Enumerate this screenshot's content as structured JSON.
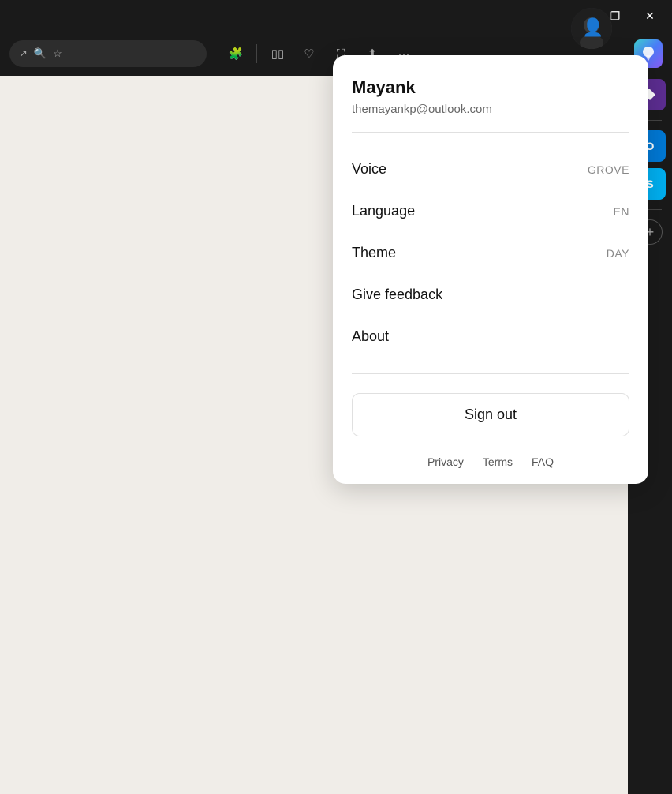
{
  "titleBar": {
    "minimizeLabel": "—",
    "restoreLabel": "❐",
    "closeLabel": "✕"
  },
  "toolbar": {
    "icons": [
      "↗",
      "🔍",
      "☆"
    ],
    "divider": true,
    "extensionIcon": "🧩",
    "readIcon": "⬜",
    "heartIcon": "♡",
    "screenshotIcon": "⛶",
    "shareIcon": "↑",
    "moreIcon": "···"
  },
  "sidebar": {
    "searchIcon": "🔍",
    "tagsIcon": "🏷",
    "outlookLabel": "O",
    "skypeLabel": "S",
    "addLabel": "+"
  },
  "profile": {
    "name": "Mayank",
    "email": "themayankp@outlook.com",
    "menuItems": [
      {
        "label": "Voice",
        "value": "GROVE"
      },
      {
        "label": "Language",
        "value": "EN"
      },
      {
        "label": "Theme",
        "value": "DAY"
      },
      {
        "label": "Give feedback",
        "value": ""
      },
      {
        "label": "About",
        "value": ""
      }
    ],
    "signOutLabel": "Sign out",
    "footerLinks": [
      "Privacy",
      "Terms",
      "FAQ"
    ]
  }
}
